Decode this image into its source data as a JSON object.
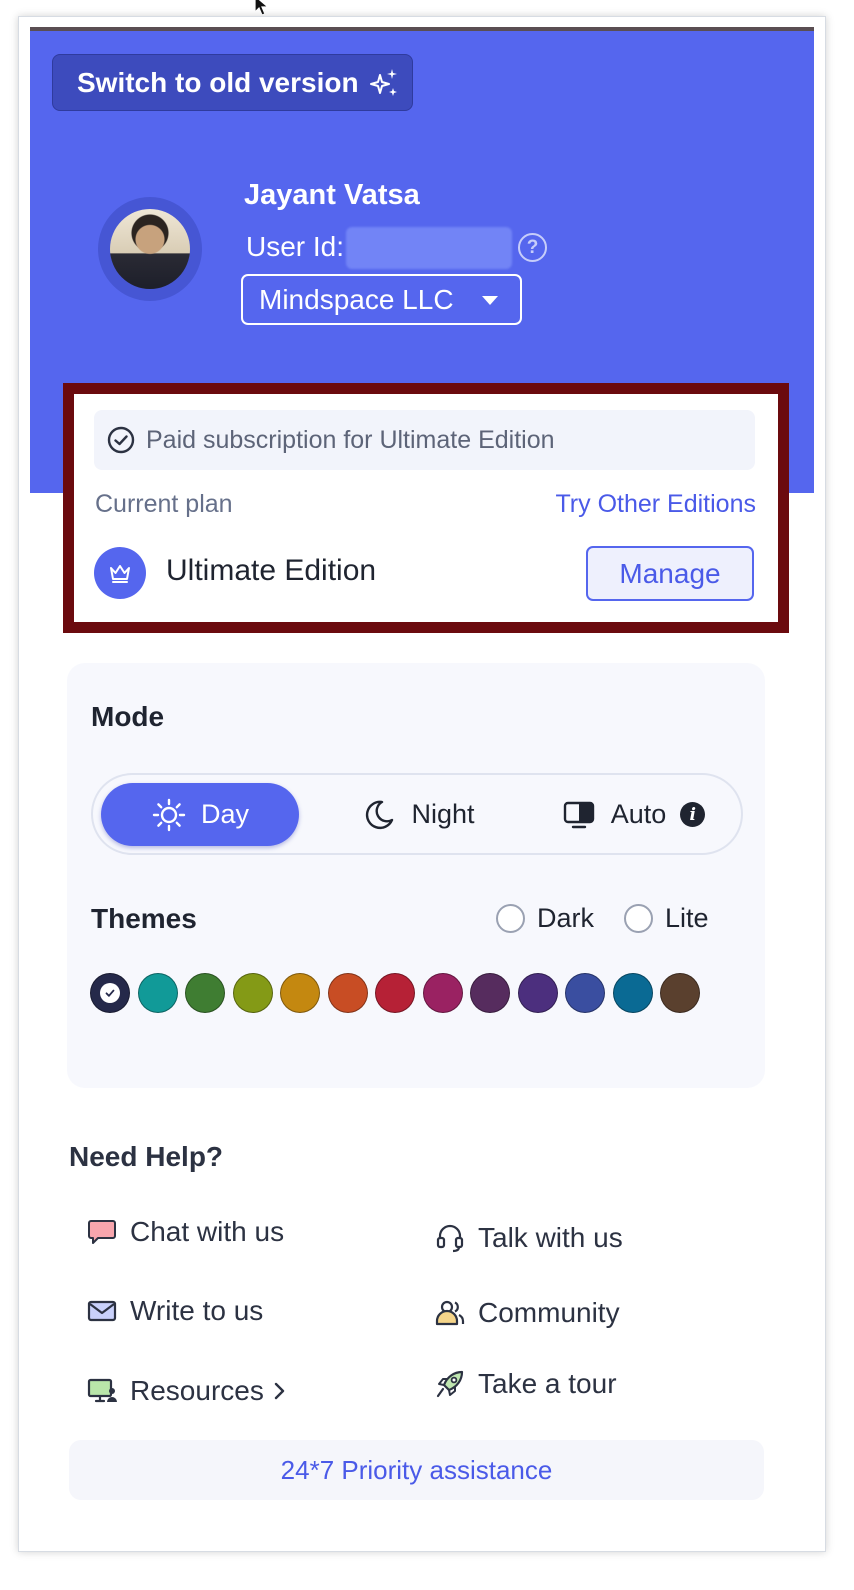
{
  "header": {
    "switch_label": "Switch to old version",
    "user_name": "Jayant Vatsa",
    "user_id_label": "User Id:",
    "org_name": "Mindspace LLC"
  },
  "plan": {
    "status": "Paid subscription for Ultimate Edition",
    "current_plan_label": "Current plan",
    "try_other_link": "Try Other Editions",
    "edition_name": "Ultimate Edition",
    "manage_label": "Manage"
  },
  "mode": {
    "title": "Mode",
    "options": [
      {
        "label": "Day",
        "icon": "sun-icon",
        "selected": true
      },
      {
        "label": "Night",
        "icon": "moon-icon",
        "selected": false
      },
      {
        "label": "Auto",
        "icon": "monitor-icon",
        "selected": false
      }
    ]
  },
  "themes": {
    "title": "Themes",
    "radio_options": [
      "Dark",
      "Lite"
    ],
    "swatches": [
      "#25294a",
      "#119a98",
      "#3f7d32",
      "#849a16",
      "#c48810",
      "#c84d24",
      "#b62136",
      "#9a2262",
      "#562c5e",
      "#4c2f7e",
      "#3a4ea0",
      "#0a6a94",
      "#5a402e"
    ],
    "selected_index": 0
  },
  "help": {
    "title": "Need Help?",
    "items": [
      {
        "label": "Chat with us",
        "icon": "chat-bubble-icon"
      },
      {
        "label": "Talk with us",
        "icon": "headset-icon"
      },
      {
        "label": "Write to us",
        "icon": "envelope-icon"
      },
      {
        "label": "Community",
        "icon": "community-icon"
      },
      {
        "label": "Resources",
        "icon": "resources-icon"
      },
      {
        "label": "Take a tour",
        "icon": "rocket-icon"
      }
    ],
    "priority": "24*7 Priority assistance"
  },
  "colors": {
    "brand": "#5566ee",
    "highlight_frame": "#6b0a0e",
    "link": "#4a5ae8"
  }
}
